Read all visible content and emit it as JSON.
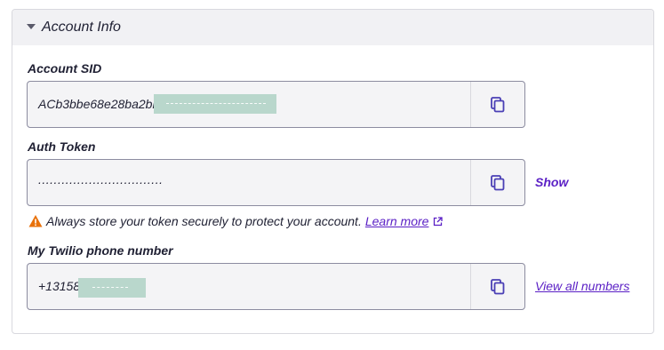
{
  "section": {
    "title": "Account Info"
  },
  "account_sid": {
    "label": "Account SID",
    "value": "ACb3bbe68e28ba2bb"
  },
  "auth_token": {
    "label": "Auth Token",
    "value": "................................",
    "show_label": "Show"
  },
  "warning": {
    "text": "Always store your token securely to protect your account.",
    "link_label": "Learn more"
  },
  "phone": {
    "label": "My Twilio phone number",
    "value": "+13158",
    "view_all_label": "View all numbers"
  },
  "colors": {
    "accent": "#5a1fc5",
    "warning": "#e8710a",
    "header_bg": "#f1f1f4",
    "redaction": "#b9d7cc"
  },
  "icons": {
    "collapse": "caret-down-icon",
    "copy": "copy-icon",
    "warning": "warning-triangle-icon",
    "external_link": "external-link-icon"
  }
}
